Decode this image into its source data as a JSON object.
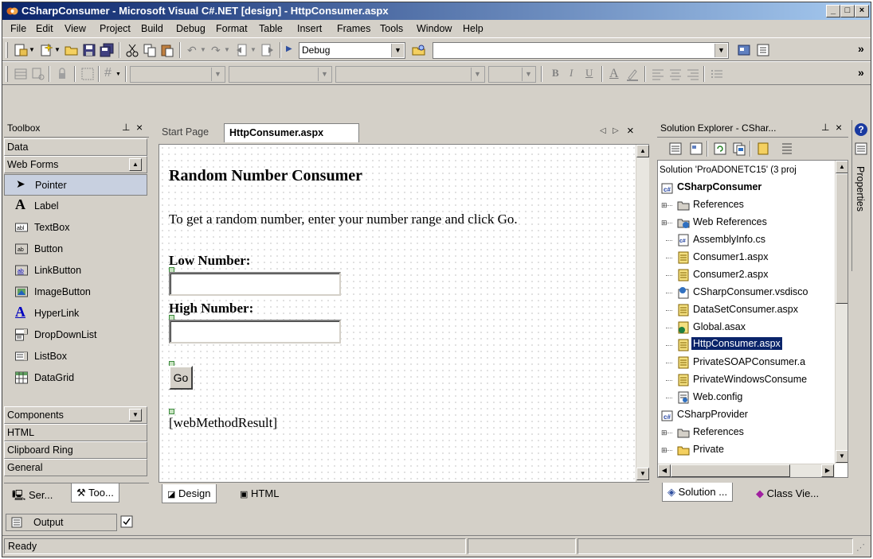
{
  "window": {
    "title": "CSharpConsumer - Microsoft Visual C#.NET [design] - HttpConsumer.aspx"
  },
  "menu": [
    "File",
    "Edit",
    "View",
    "Project",
    "Build",
    "Debug",
    "Format",
    "Table",
    "Insert",
    "Frames",
    "Tools",
    "Window",
    "Help"
  ],
  "toolbar": {
    "config": "Debug",
    "overflow": "»"
  },
  "toolbox": {
    "title": "Toolbox",
    "categories_top": [
      "Data",
      "Web Forms"
    ],
    "items": [
      {
        "label": "Pointer",
        "icon": "pointer-icon"
      },
      {
        "label": "Label",
        "icon": "label-icon"
      },
      {
        "label": "TextBox",
        "icon": "textbox-icon"
      },
      {
        "label": "Button",
        "icon": "button-icon"
      },
      {
        "label": "LinkButton",
        "icon": "linkbutton-icon"
      },
      {
        "label": "ImageButton",
        "icon": "imagebutton-icon"
      },
      {
        "label": "HyperLink",
        "icon": "hyperlink-icon"
      },
      {
        "label": "DropDownList",
        "icon": "dropdownlist-icon"
      },
      {
        "label": "ListBox",
        "icon": "listbox-icon"
      },
      {
        "label": "DataGrid",
        "icon": "datagrid-icon"
      }
    ],
    "categories_bottom": [
      "Components",
      "HTML",
      "Clipboard Ring",
      "General"
    ],
    "bottom_tabs": [
      "Ser...",
      "Too..."
    ]
  },
  "editor": {
    "tabs": [
      "Start Page",
      "HttpConsumer.aspx"
    ],
    "page": {
      "heading": "Random Number Consumer",
      "instructions": "To get a random number, enter your number range and click Go.",
      "low_label": "Low Number:",
      "high_label": "High Number:",
      "go_button": "Go",
      "result": "[webMethodResult]"
    },
    "view_tabs": [
      "Design",
      "HTML"
    ]
  },
  "solution_explorer": {
    "title": "Solution Explorer - CShar...",
    "solution": "Solution 'ProADONETC15' (3 proj",
    "items": [
      {
        "label": "CSharpConsumer",
        "bold": true,
        "icon": "csharp-project-icon"
      },
      {
        "label": "References",
        "icon": "references-icon"
      },
      {
        "label": "Web References",
        "icon": "web-references-icon"
      },
      {
        "label": "AssemblyInfo.cs",
        "icon": "cs-file-icon"
      },
      {
        "label": "Consumer1.aspx",
        "icon": "aspx-file-icon"
      },
      {
        "label": "Consumer2.aspx",
        "icon": "aspx-file-icon"
      },
      {
        "label": "CSharpConsumer.vsdisco",
        "icon": "vsdisco-file-icon"
      },
      {
        "label": "DataSetConsumer.aspx",
        "icon": "aspx-file-icon"
      },
      {
        "label": "Global.asax",
        "icon": "asax-file-icon"
      },
      {
        "label": "HttpConsumer.aspx",
        "icon": "aspx-file-icon",
        "selected": true
      },
      {
        "label": "PrivateSOAPConsumer.a",
        "icon": "aspx-file-icon"
      },
      {
        "label": "PrivateWindowsConsume",
        "icon": "aspx-file-icon"
      },
      {
        "label": "Web.config",
        "icon": "config-file-icon"
      },
      {
        "label": "CSharpProvider",
        "icon": "csharp-project-icon"
      },
      {
        "label": "References",
        "icon": "references-icon"
      },
      {
        "label": "Private",
        "icon": "folder-icon"
      }
    ],
    "bottom_tabs": [
      "Solution ...",
      "Class Vie..."
    ]
  },
  "properties_tab": "Properties",
  "output": {
    "label": "Output"
  },
  "status": {
    "text": "Ready"
  },
  "colors": {
    "titlebar_start": "#0a246a",
    "titlebar_end": "#a6caf0",
    "selection": "#0a246a",
    "chrome": "#d4d0c8"
  }
}
